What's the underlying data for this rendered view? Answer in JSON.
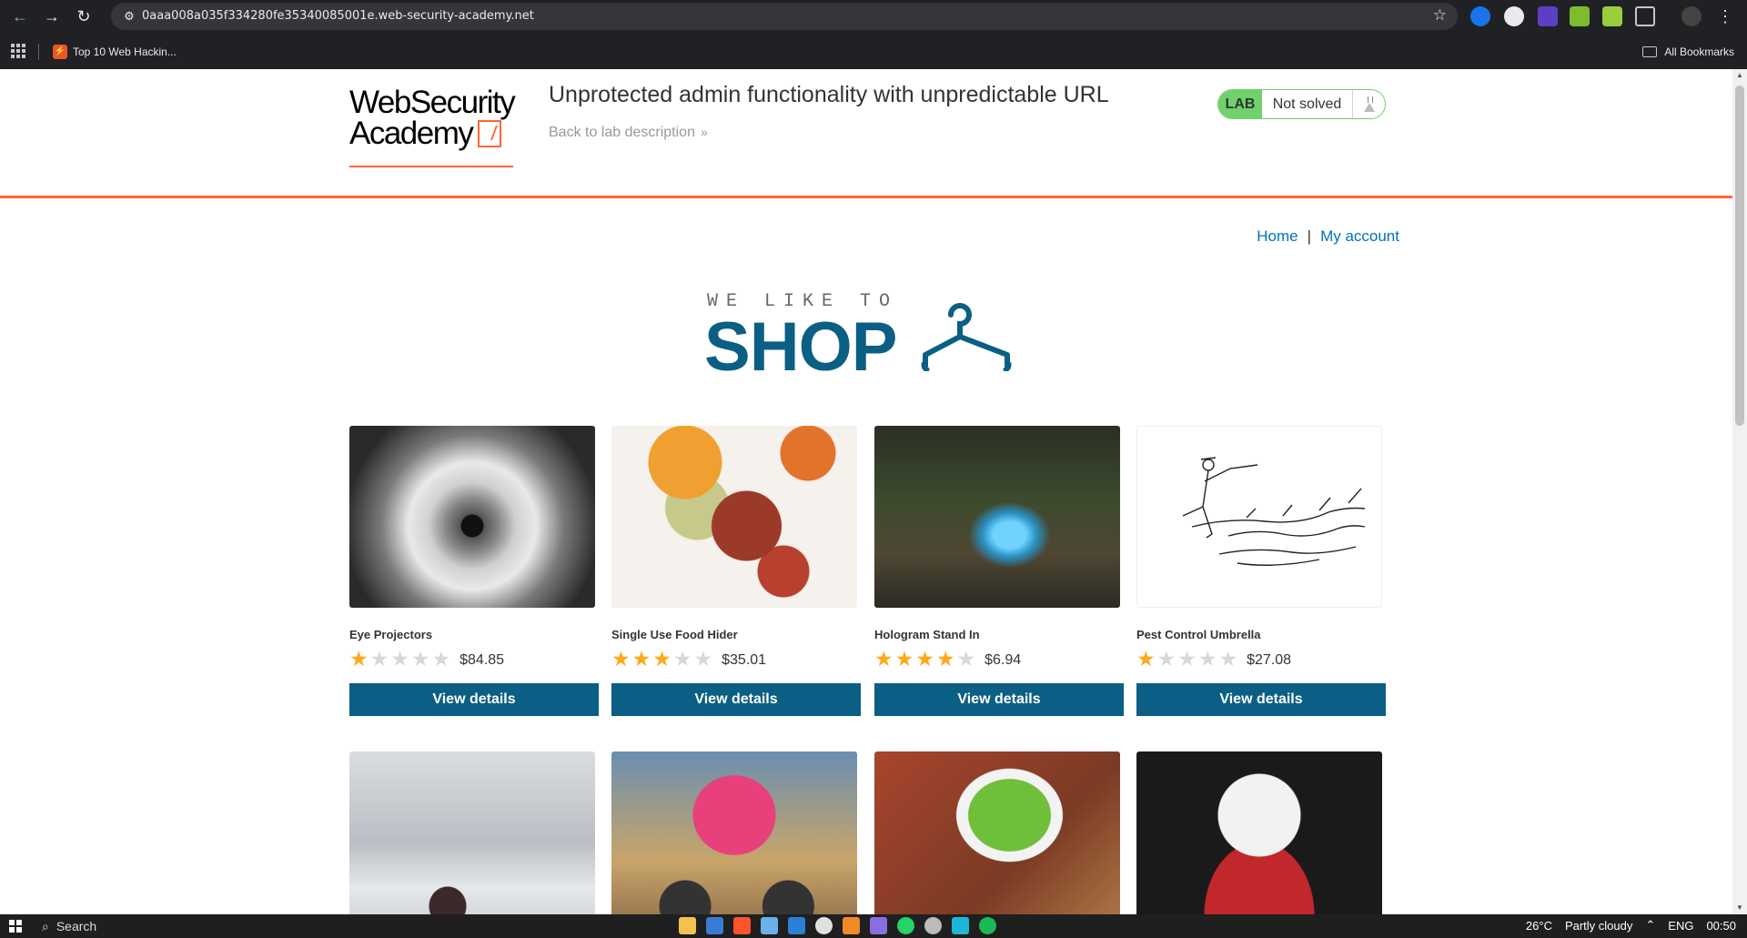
{
  "browser": {
    "url": "0aaa008a035f334280fe35340085001e.web-security-academy.net",
    "bookmark": "Top 10 Web Hackin...",
    "bookmark_favicon": "⚡",
    "all_bookmarks": "All Bookmarks"
  },
  "academy": {
    "logo_line1": "WebSecurity",
    "logo_line2": "Academy",
    "lab_title": "Unprotected admin functionality with unpredictable URL",
    "back_link": "Back to lab description",
    "lab_tag": "LAB",
    "lab_status": "Not solved",
    "status_color": "#70d16d",
    "accent_color": "#ff6633"
  },
  "nav": {
    "home": "Home",
    "separator": "|",
    "account": "My account"
  },
  "banner": {
    "tagline": "WE LIKE TO",
    "shop": "SHOP"
  },
  "products": [
    {
      "name": "Eye Projectors",
      "rating": 1,
      "price": "$84.85",
      "button": "View details"
    },
    {
      "name": "Single Use Food Hider",
      "rating": 3,
      "price": "$35.01",
      "button": "View details"
    },
    {
      "name": "Hologram Stand In",
      "rating": 4,
      "price": "$6.94",
      "button": "View details"
    },
    {
      "name": "Pest Control Umbrella",
      "rating": 1,
      "price": "$27.08",
      "button": "View details"
    }
  ],
  "taskbar": {
    "search": "Search",
    "weather": "26°C",
    "weather_desc": "Partly cloudy",
    "lang": "ENG",
    "time": "00:50"
  }
}
